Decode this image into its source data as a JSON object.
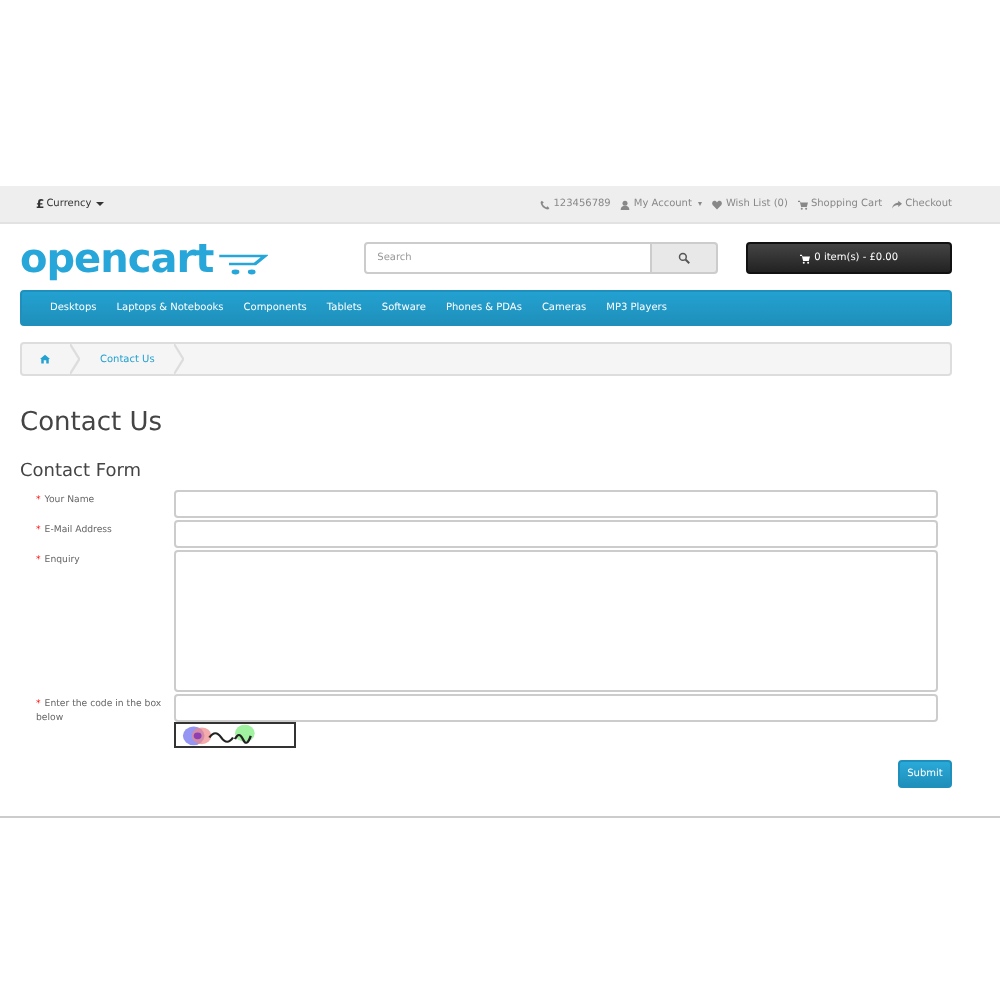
{
  "top_bar": {
    "currency": {
      "symbol": "£",
      "label": "Currency"
    },
    "links": [
      {
        "kind": "phone",
        "label": "123456789",
        "dropdown": false
      },
      {
        "kind": "user",
        "label": "My Account",
        "dropdown": true
      },
      {
        "kind": "heart",
        "label": "Wish List (0)",
        "dropdown": false
      },
      {
        "kind": "cart",
        "label": "Shopping Cart",
        "dropdown": false
      },
      {
        "kind": "share",
        "label": "Checkout",
        "dropdown": false
      }
    ]
  },
  "header": {
    "logo": "opencart",
    "search": {
      "placeholder": "Search"
    },
    "cart_button": "0 item(s) - £0.00"
  },
  "nav": {
    "items": [
      "Desktops",
      "Laptops & Notebooks",
      "Components",
      "Tablets",
      "Software",
      "Phones & PDAs",
      "Cameras",
      "MP3 Players"
    ]
  },
  "breadcrumb": [
    {
      "kind": "home"
    },
    {
      "kind": "text",
      "label": "Contact Us"
    }
  ],
  "title": "Contact Us",
  "form": {
    "heading": "Contact Form",
    "fields": [
      {
        "kind": "text",
        "required_mark": "*",
        "label": "Your Name"
      },
      {
        "kind": "text",
        "required_mark": "*",
        "label": "E-Mail Address"
      },
      {
        "kind": "textarea",
        "required_mark": "*",
        "label": "Enquiry"
      },
      {
        "kind": "captcha",
        "required_mark": "*",
        "label": "Enter the code in the box below"
      }
    ],
    "submit": "Submit"
  }
}
